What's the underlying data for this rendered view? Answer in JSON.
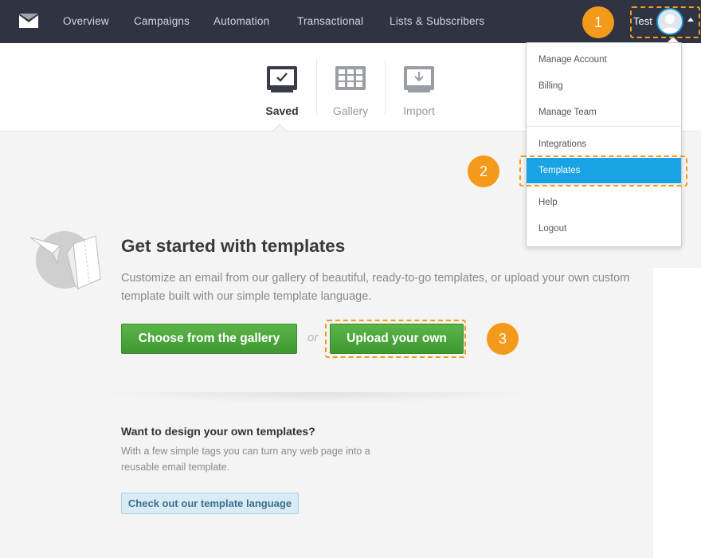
{
  "nav": {
    "items": [
      "Overview",
      "Campaigns",
      "Automation",
      "Transactional",
      "Lists & Subscribers"
    ],
    "user_name": "Test"
  },
  "subnav": {
    "tabs": [
      {
        "label": "Saved",
        "active": true
      },
      {
        "label": "Gallery",
        "active": false
      },
      {
        "label": "Import",
        "active": false
      }
    ]
  },
  "dropdown": {
    "items": [
      "Manage Account",
      "Billing",
      "Manage Team",
      "Integrations",
      "Templates",
      "Help",
      "Logout"
    ],
    "active_item": "Templates"
  },
  "annotations": [
    "1",
    "2",
    "3"
  ],
  "main": {
    "title": "Get started with templates",
    "description": "Customize an email from our gallery of beautiful, ready-to-go templates, or upload your own custom template built with our simple template language.",
    "gallery_button": "Choose from the gallery",
    "or": "or",
    "upload_button": "Upload your own"
  },
  "design": {
    "title": "Want to design your own templates?",
    "description": "With a few simple tags you can turn any web page into a reusable email template.",
    "link_button": "Check out our template language"
  },
  "colors": {
    "nav_bg": "#2f3342",
    "accent_blue": "#1aa3e4",
    "annotation_orange": "#f39a1a",
    "button_green": "#4aa83b"
  }
}
